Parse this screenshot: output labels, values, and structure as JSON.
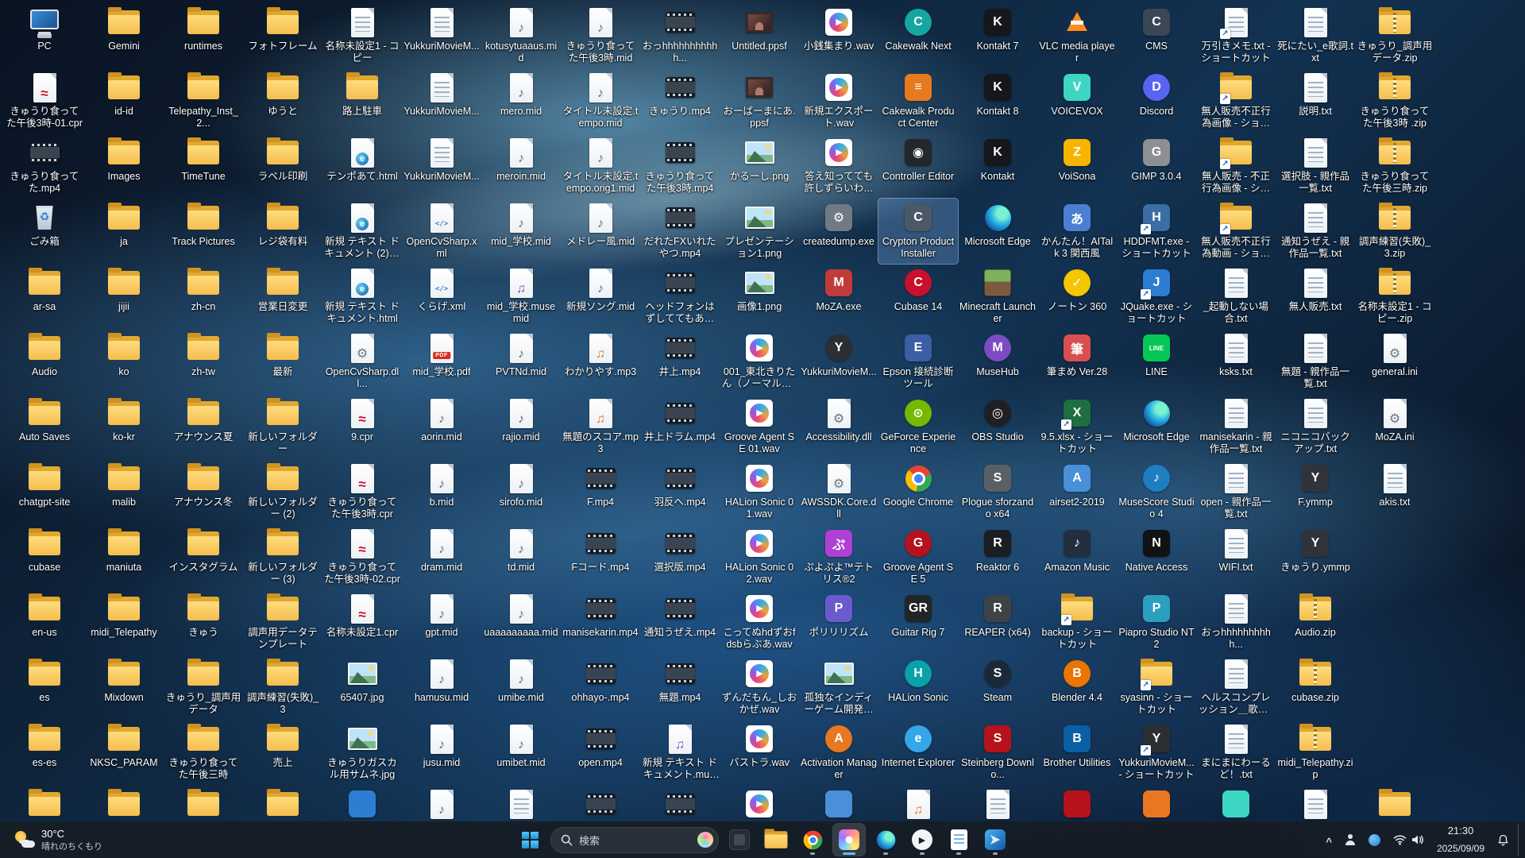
{
  "desktop": {
    "columns": 18,
    "selected_label": "Crypton Product Installer",
    "icons": [
      {
        "l": "PC",
        "t": "pc"
      },
      {
        "l": "Gemini",
        "t": "folder"
      },
      {
        "l": "runtimes",
        "t": "folder"
      },
      {
        "l": "フォトフレーム",
        "t": "folder"
      },
      {
        "l": "名称未設定1 - コピー",
        "t": "file"
      },
      {
        "l": "YukkuriMovieM...",
        "t": "file"
      },
      {
        "l": "kotusytuaaus.mid",
        "t": "mid"
      },
      {
        "l": "きゅうり食ってた午後3時.mid",
        "t": "mid"
      },
      {
        "l": "おっhhhhhhhhhhh...",
        "t": "mp4"
      },
      {
        "l": "Untitled.ppsf",
        "t": "ppsf"
      },
      {
        "l": "小銭集まり.wav",
        "t": "wav"
      },
      {
        "l": "Cakewalk Next",
        "t": "app",
        "b": "#16a6a0",
        "g": "C",
        "s": 1
      },
      {
        "l": "Kontakt 7",
        "t": "app",
        "b": "#15171a",
        "g": "K"
      },
      {
        "l": "VLC media player",
        "t": "vlc"
      },
      {
        "l": "CMS",
        "t": "app",
        "b": "#3a4754",
        "g": "C"
      },
      {
        "l": "万引きメモ.txt - ショートカット",
        "t": "txt",
        "sc": 1
      },
      {
        "l": "死にたい_e歌詞.txt",
        "t": "txt"
      },
      {
        "l": "きゅうり_調声用データ.zip",
        "t": "zip"
      },
      {
        "l": "きゅうり食ってた午後3時-01.cpr",
        "t": "cpr"
      },
      {
        "l": "id-id",
        "t": "folder"
      },
      {
        "l": "Telepathy_Inst_2...",
        "t": "folder"
      },
      {
        "l": "ゆうと",
        "t": "folder"
      },
      {
        "l": "路上駐車",
        "t": "folder"
      },
      {
        "l": "YukkuriMovieM...",
        "t": "file"
      },
      {
        "l": "mero.mid",
        "t": "mid"
      },
      {
        "l": "タイトル未設定.tempo.mid",
        "t": "mid"
      },
      {
        "l": "きゅうり.mp4",
        "t": "mp4"
      },
      {
        "l": "おーばーまにあ.ppsf",
        "t": "ppsf"
      },
      {
        "l": "新規エクスポート.wav",
        "t": "wav"
      },
      {
        "l": "Cakewalk Product Center",
        "t": "app",
        "b": "#e87a1e",
        "g": "≡"
      },
      {
        "l": "Kontakt 8",
        "t": "app",
        "b": "#15171a",
        "g": "K"
      },
      {
        "l": "VOICEVOX",
        "t": "app",
        "b": "#3dd6c3",
        "g": "V"
      },
      {
        "l": "Discord",
        "t": "app",
        "b": "#5865f2",
        "g": "D",
        "s": 1
      },
      {
        "l": "無人販売不正行為画像 - ショートカッ...",
        "t": "folder",
        "sc": 1
      },
      {
        "l": "説明.txt",
        "t": "txt"
      },
      {
        "l": "きゅうり食ってた午後3時 .zip",
        "t": "zip"
      },
      {
        "l": "きゅうり食ってた.mp4",
        "t": "mp4"
      },
      {
        "l": "Images",
        "t": "folder"
      },
      {
        "l": "TimeTune",
        "t": "folder"
      },
      {
        "l": "ラベル印刷",
        "t": "folder"
      },
      {
        "l": "テンポあて.html",
        "t": "html"
      },
      {
        "l": "YukkuriMovieM...",
        "t": "file"
      },
      {
        "l": "meroin.mid",
        "t": "mid"
      },
      {
        "l": "タイトル未設定.tempo.orig1.mid",
        "t": "mid"
      },
      {
        "l": "きゅうり食ってた午後3時.mp4",
        "t": "mp4"
      },
      {
        "l": "かるーし.png",
        "t": "img"
      },
      {
        "l": "答え知ってても許しずらいわこれ.wav",
        "t": "wav"
      },
      {
        "l": "Controller Editor",
        "t": "app",
        "b": "#23272b",
        "g": "◉"
      },
      {
        "l": "Kontakt",
        "t": "app",
        "b": "#15171a",
        "g": "K"
      },
      {
        "l": "VoiSona",
        "t": "app",
        "b": "#f7b500",
        "g": "Z"
      },
      {
        "l": "GIMP 3.0.4",
        "t": "app",
        "b": "#8d8f92",
        "g": "G"
      },
      {
        "l": "無人販売 - 不正行為画像 - ショートカット",
        "t": "folder",
        "sc": 1
      },
      {
        "l": "選択肢 - 親作品一覧.txt",
        "t": "txt"
      },
      {
        "l": "きゅうり食ってた午後三時.zip",
        "t": "zip"
      },
      {
        "l": "ごみ箱",
        "t": "recycle"
      },
      {
        "l": "ja",
        "t": "folder"
      },
      {
        "l": "Track Pictures",
        "t": "folder"
      },
      {
        "l": "レジ袋有料",
        "t": "folder"
      },
      {
        "l": "新規 テキスト ドキュメント (2).html",
        "t": "html"
      },
      {
        "l": "OpenCvSharp.xml",
        "t": "xml"
      },
      {
        "l": "mid_学校.mid",
        "t": "mid"
      },
      {
        "l": "メドレー風.mid",
        "t": "mid"
      },
      {
        "l": "だれたFXいれたやつ.mp4",
        "t": "mp4"
      },
      {
        "l": "プレゼンテーション1.png",
        "t": "img"
      },
      {
        "l": "createdump.exe",
        "t": "app",
        "b": "#6f7a85",
        "g": "⚙"
      },
      {
        "l": "Crypton Product Installer",
        "t": "app",
        "b": "#4b5866",
        "g": "C",
        "sel": 1
      },
      {
        "l": "Microsoft Edge",
        "t": "edge"
      },
      {
        "l": "かんたん！AITalk 3 関西風",
        "t": "app",
        "b": "#4a7fd4",
        "g": "あ"
      },
      {
        "l": "HDDFMT.exe - ショートカット",
        "t": "app",
        "b": "#3b6ea5",
        "g": "H",
        "sc": 1
      },
      {
        "l": "無人販売不正行為動画 - ショートカット",
        "t": "folder",
        "sc": 1
      },
      {
        "l": "通知うぜえ - 親作品一覧.txt",
        "t": "txt"
      },
      {
        "l": "調声練習(失敗)_3.zip",
        "t": "zip"
      },
      {
        "l": "ar-sa",
        "t": "folder"
      },
      {
        "l": "jijii",
        "t": "folder"
      },
      {
        "l": "zh-cn",
        "t": "folder"
      },
      {
        "l": "営業日変更",
        "t": "folder"
      },
      {
        "l": "新規 テキスト ドキュメント.html",
        "t": "html"
      },
      {
        "l": "くらげ.xml",
        "t": "xml"
      },
      {
        "l": "mid_学校.musemid",
        "t": "mxml"
      },
      {
        "l": "新規ソング.mid",
        "t": "mid"
      },
      {
        "l": "ヘッドフォンはずしててもあがつがない.mp4",
        "t": "mp4"
      },
      {
        "l": "画像1.png",
        "t": "img"
      },
      {
        "l": "MoZA.exe",
        "t": "app",
        "b": "#c23b3b",
        "g": "M"
      },
      {
        "l": "Cubase 14",
        "t": "app",
        "b": "#c8102e",
        "g": "C",
        "s": 1
      },
      {
        "l": "Minecraft Launcher",
        "t": "minecraft"
      },
      {
        "l": "ノートン 360",
        "t": "app",
        "b": "#f4c700",
        "g": "✓",
        "s": 1
      },
      {
        "l": "JQuake.exe - ショートカット",
        "t": "app",
        "b": "#2d7dd2",
        "g": "J",
        "sc": 1
      },
      {
        "l": "_起動しない場合.txt",
        "t": "txt"
      },
      {
        "l": "無人販売.txt",
        "t": "txt"
      },
      {
        "l": "名称未設定1 - コピー.zip",
        "t": "zip"
      },
      {
        "l": "Audio",
        "t": "folder"
      },
      {
        "l": "ko",
        "t": "folder"
      },
      {
        "l": "zh-tw",
        "t": "folder"
      },
      {
        "l": "最新",
        "t": "folder"
      },
      {
        "l": "OpenCvSharp.dll...",
        "t": "gearfile"
      },
      {
        "l": "mid_学校.pdf",
        "t": "pdf"
      },
      {
        "l": "PVTNd.mid",
        "t": "mid"
      },
      {
        "l": "わかりやす.mp3",
        "t": "mp3"
      },
      {
        "l": "井上.mp4",
        "t": "mp4"
      },
      {
        "l": "001_東北きりたん（ノーマル）_今しゃ...",
        "t": "wav"
      },
      {
        "l": "YukkuriMovieM...",
        "t": "app",
        "b": "#2b2f33",
        "g": "Y",
        "s": 1
      },
      {
        "l": "Epson 接続診断ツール",
        "t": "app",
        "b": "#3b5ea5",
        "g": "E"
      },
      {
        "l": "MuseHub",
        "t": "app",
        "b": "#7d4bc3",
        "g": "M",
        "s": 1
      },
      {
        "l": "筆まめ Ver.28",
        "t": "app",
        "b": "#d94f4f",
        "g": "筆"
      },
      {
        "l": "LINE",
        "t": "app",
        "b": "#06c755",
        "g": "LINE"
      },
      {
        "l": "ksks.txt",
        "t": "txt"
      },
      {
        "l": "無題 - 親作品一覧.txt",
        "t": "txt"
      },
      {
        "l": "general.ini",
        "t": "gearfile"
      },
      {
        "l": "Auto Saves",
        "t": "folder"
      },
      {
        "l": "ko-kr",
        "t": "folder"
      },
      {
        "l": "アナウンス夏",
        "t": "folder"
      },
      {
        "l": "新しいフォルダー",
        "t": "folder"
      },
      {
        "l": "9.cpr",
        "t": "cpr"
      },
      {
        "l": "aorin.mid",
        "t": "mid"
      },
      {
        "l": "rajio.mid",
        "t": "mid"
      },
      {
        "l": "無題のスコア.mp3",
        "t": "mp3"
      },
      {
        "l": "井上ドラム.mp4",
        "t": "mp4"
      },
      {
        "l": "Groove Agent SE 01.wav",
        "t": "wav"
      },
      {
        "l": "Accessibility.dll",
        "t": "gearfile"
      },
      {
        "l": "GeForce Experience",
        "t": "app",
        "b": "#76b900",
        "g": "⊙",
        "s": 1
      },
      {
        "l": "OBS Studio",
        "t": "app",
        "b": "#1f1f23",
        "g": "◎",
        "s": 1
      },
      {
        "l": "9.5.xlsx - ショートカット",
        "t": "app",
        "b": "#1d6f42",
        "g": "X",
        "sc": 1
      },
      {
        "l": "Microsoft Edge",
        "t": "edge"
      },
      {
        "l": "manisekarin - 親作品一覧.txt",
        "t": "txt"
      },
      {
        "l": "ニコニコバックアップ.txt",
        "t": "txt"
      },
      {
        "l": "MoZA.ini",
        "t": "gearfile"
      },
      {
        "l": "chatgpt-site",
        "t": "folder"
      },
      {
        "l": "malib",
        "t": "folder"
      },
      {
        "l": "アナウンス冬",
        "t": "folder"
      },
      {
        "l": "新しいフォルダー (2)",
        "t": "folder"
      },
      {
        "l": "きゅうり食ってた午後3時.cpr",
        "t": "cpr"
      },
      {
        "l": "b.mid",
        "t": "mid"
      },
      {
        "l": "sirofo.mid",
        "t": "mid"
      },
      {
        "l": "F.mp4",
        "t": "mp4"
      },
      {
        "l": "羽反へ.mp4",
        "t": "mp4"
      },
      {
        "l": "HALion Sonic 01.wav",
        "t": "wav"
      },
      {
        "l": "AWSSDK.Core.dll",
        "t": "gearfile"
      },
      {
        "l": "Google Chrome",
        "t": "chrome"
      },
      {
        "l": "Plogue sforzando x64",
        "t": "app",
        "b": "#5a5f66",
        "g": "S"
      },
      {
        "l": "airset2-2019",
        "t": "app",
        "b": "#4a90d9",
        "g": "A"
      },
      {
        "l": "MuseScore Studio 4",
        "t": "app",
        "b": "#1f7ec2",
        "g": "♪",
        "s": 1
      },
      {
        "l": "open - 親作品一覧.txt",
        "t": "txt"
      },
      {
        "l": "F.ymmp",
        "t": "app",
        "b": "#30343a",
        "g": "Y"
      },
      {
        "l": "akis.txt",
        "t": "txt"
      },
      {
        "l": "cubase",
        "t": "folder"
      },
      {
        "l": "maniuta",
        "t": "folder"
      },
      {
        "l": "インスタグラム",
        "t": "folder"
      },
      {
        "l": "新しいフォルダー (3)",
        "t": "folder"
      },
      {
        "l": "きゅうり食ってた午後3時-02.cpr",
        "t": "cpr"
      },
      {
        "l": "dram.mid",
        "t": "mid"
      },
      {
        "l": "td.mid",
        "t": "mid"
      },
      {
        "l": "Fコード.mp4",
        "t": "mp4"
      },
      {
        "l": "選択版.mp4",
        "t": "mp4"
      },
      {
        "l": "HALion Sonic 02.wav",
        "t": "wav"
      },
      {
        "l": "ぷよぷよ™テトリス®2",
        "t": "app",
        "b": "#b03fd4",
        "g": "ぷ"
      },
      {
        "l": "Groove Agent SE 5",
        "t": "app",
        "b": "#b5121b",
        "g": "G",
        "s": 1
      },
      {
        "l": "Reaktor 6",
        "t": "app",
        "b": "#1a1d21",
        "g": "R"
      },
      {
        "l": "Amazon Music",
        "t": "app",
        "b": "#232f3e",
        "g": "♪"
      },
      {
        "l": "Native Access",
        "t": "app",
        "b": "#101214",
        "g": "N"
      },
      {
        "l": "WIFI.txt",
        "t": "txt"
      },
      {
        "l": "きゅうり.ymmp",
        "t": "app",
        "b": "#30343a",
        "g": "Y"
      },
      {
        "l": "",
        "t": "empty"
      },
      {
        "l": "en-us",
        "t": "folder"
      },
      {
        "l": "midi_Telepathy",
        "t": "folder"
      },
      {
        "l": "きゅう",
        "t": "folder"
      },
      {
        "l": "調声用データテンプレート",
        "t": "folder"
      },
      {
        "l": "名称未設定1.cpr",
        "t": "cpr"
      },
      {
        "l": "gpt.mid",
        "t": "mid"
      },
      {
        "l": "uaaaaaaaaa.mid",
        "t": "mid"
      },
      {
        "l": "manisekarin.mp4",
        "t": "mp4"
      },
      {
        "l": "通知うぜえ.mp4",
        "t": "mp4"
      },
      {
        "l": "こってぬhdずおfdsbらぶあ.wav",
        "t": "wav"
      },
      {
        "l": "ポリリリズム",
        "t": "app",
        "b": "#6a5acd",
        "g": "P"
      },
      {
        "l": "Guitar Rig 7",
        "t": "app",
        "b": "#222528",
        "g": "GR"
      },
      {
        "l": "REAPER (x64)",
        "t": "app",
        "b": "#3e4347",
        "g": "R"
      },
      {
        "l": "backup - ショートカット",
        "t": "folder",
        "sc": 1
      },
      {
        "l": "Piapro Studio NT2",
        "t": "app",
        "b": "#2b9fbe",
        "g": "P"
      },
      {
        "l": "おっhhhhhhhhhh...",
        "t": "file"
      },
      {
        "l": "Audio.zip",
        "t": "zip"
      },
      {
        "l": "",
        "t": "empty"
      },
      {
        "l": "es",
        "t": "folder"
      },
      {
        "l": "Mixdown",
        "t": "folder"
      },
      {
        "l": "きゅうり_調声用データ",
        "t": "folder"
      },
      {
        "l": "調声練習(失敗)_3",
        "t": "folder"
      },
      {
        "l": "65407.jpg",
        "t": "img"
      },
      {
        "l": "hamusu.mid",
        "t": "mid"
      },
      {
        "l": "umibe.mid",
        "t": "mid"
      },
      {
        "l": "ohhayo-.mp4",
        "t": "mp4"
      },
      {
        "l": "無題.mp4",
        "t": "mp4"
      },
      {
        "l": "ずんだもん_しおかぜ.wav",
        "t": "wav"
      },
      {
        "l": "孤独なインディーゲーム開発者の一生 ...",
        "t": "img"
      },
      {
        "l": "HALion Sonic",
        "t": "app",
        "b": "#0aa1a8",
        "g": "H",
        "s": 1
      },
      {
        "l": "Steam",
        "t": "app",
        "b": "#1b2838",
        "g": "S",
        "s": 1
      },
      {
        "l": "Blender 4.4",
        "t": "app",
        "b": "#ea7600",
        "g": "B",
        "s": 1
      },
      {
        "l": "syasinn - ショートカット",
        "t": "folder",
        "sc": 1
      },
      {
        "l": "ヘルスコンプレッション＿歌詞.txt",
        "t": "txt"
      },
      {
        "l": "cubase.zip",
        "t": "zip"
      },
      {
        "l": "",
        "t": "empty"
      },
      {
        "l": "es-es",
        "t": "folder"
      },
      {
        "l": "NKSC_PARAM",
        "t": "folder"
      },
      {
        "l": "きゅうり食ってた午後三時",
        "t": "folder"
      },
      {
        "l": "売上",
        "t": "folder"
      },
      {
        "l": "きゅうりガスカル用サムネ.jpg",
        "t": "img"
      },
      {
        "l": "jusu.mid",
        "t": "mid"
      },
      {
        "l": "umibet.mid",
        "t": "mid"
      },
      {
        "l": "open.mp4",
        "t": "mp4"
      },
      {
        "l": "新規 テキスト ドキュメント.musicxml",
        "t": "mxml"
      },
      {
        "l": "バストラ.wav",
        "t": "wav"
      },
      {
        "l": "Activation Manager",
        "t": "app",
        "b": "#e87722",
        "g": "A",
        "s": 1
      },
      {
        "l": "Internet Explorer",
        "t": "app",
        "b": "#35a6e8",
        "g": "e",
        "s": 1
      },
      {
        "l": "Steinberg Downlo...",
        "t": "app",
        "b": "#b5121b",
        "g": "S"
      },
      {
        "l": "Brother Utilities",
        "t": "app",
        "b": "#0a5fa4",
        "g": "B"
      },
      {
        "l": "YukkuriMovieM... - ショートカット",
        "t": "app",
        "b": "#2b2f33",
        "g": "Y",
        "sc": 1
      },
      {
        "l": "まにまにわーるど！.txt",
        "t": "txt"
      },
      {
        "l": "midi_Telepathy.zip",
        "t": "zip"
      },
      {
        "l": "",
        "t": "empty"
      },
      {
        "l": "",
        "t": "folder"
      },
      {
        "l": "",
        "t": "folder"
      },
      {
        "l": "",
        "t": "folder"
      },
      {
        "l": "",
        "t": "folder"
      },
      {
        "l": "",
        "t": "app",
        "b": "#2d7dd2",
        "g": ""
      },
      {
        "l": "",
        "t": "mid"
      },
      {
        "l": "",
        "t": "file"
      },
      {
        "l": "",
        "t": "mp4"
      },
      {
        "l": "",
        "t": "mp4"
      },
      {
        "l": "",
        "t": "wav"
      },
      {
        "l": "",
        "t": "app",
        "b": "#4a90d9",
        "g": ""
      },
      {
        "l": "",
        "t": "mp3"
      },
      {
        "l": "",
        "t": "file"
      },
      {
        "l": "",
        "t": "app",
        "b": "#b5121b",
        "g": ""
      },
      {
        "l": "",
        "t": "app",
        "b": "#e87722",
        "g": ""
      },
      {
        "l": "",
        "t": "app",
        "b": "#3dd6c3",
        "g": ""
      },
      {
        "l": "",
        "t": "file"
      },
      {
        "l": "",
        "t": "folder"
      }
    ]
  },
  "taskbar": {
    "weather": {
      "temp": "30°C",
      "condition": "晴れのちくもり"
    },
    "search": {
      "placeholder": "検索"
    },
    "apps": [
      {
        "id": "dark-window-app",
        "kind": "darkapp",
        "run": 0,
        "active": 0
      },
      {
        "id": "file-explorer",
        "kind": "explorer",
        "run": 0,
        "active": 0
      },
      {
        "id": "chrome",
        "kind": "chrome",
        "run": 1,
        "active": 0
      },
      {
        "id": "photos-app",
        "kind": "photos",
        "run": 1,
        "active": 1
      },
      {
        "id": "edge",
        "kind": "edge",
        "run": 1,
        "active": 0
      },
      {
        "id": "media-player",
        "kind": "mediaplayer",
        "run": 1,
        "active": 0
      },
      {
        "id": "notepad",
        "kind": "notepad",
        "run": 1,
        "active": 0
      },
      {
        "id": "blue-code-app",
        "kind": "bluecode",
        "run": 1,
        "active": 0
      }
    ],
    "tray": {
      "time": "21:30",
      "date": "2025/09/09"
    }
  }
}
